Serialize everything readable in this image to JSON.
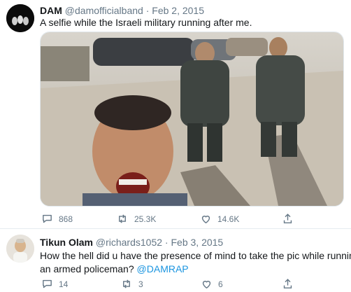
{
  "tweet1": {
    "name": "DAM",
    "handle": "@damofficialband",
    "separator": "·",
    "date": "Feb 2, 2015",
    "text": "A selfie while the Israeli military running after me.",
    "replies": "868",
    "retweets": "25.3K",
    "likes": "14.6K",
    "icons": [
      "reply-icon",
      "retweet-icon",
      "like-icon",
      "share-icon"
    ]
  },
  "tweet2": {
    "name": "Tikun Olam",
    "handle": "@richards1052",
    "separator": "·",
    "date": "Feb 3, 2015",
    "text_line1": "How the hell did u have the presence of mind to take the pic while running fr",
    "text_line2": "an armed policeman?",
    "mention": "@DAMRAP",
    "replies": "14",
    "retweets": "3",
    "likes": "6"
  },
  "colors": {
    "text": "#14171a",
    "secondary": "#657786",
    "link": "#1b95e0",
    "divider": "#e6ecf0"
  }
}
